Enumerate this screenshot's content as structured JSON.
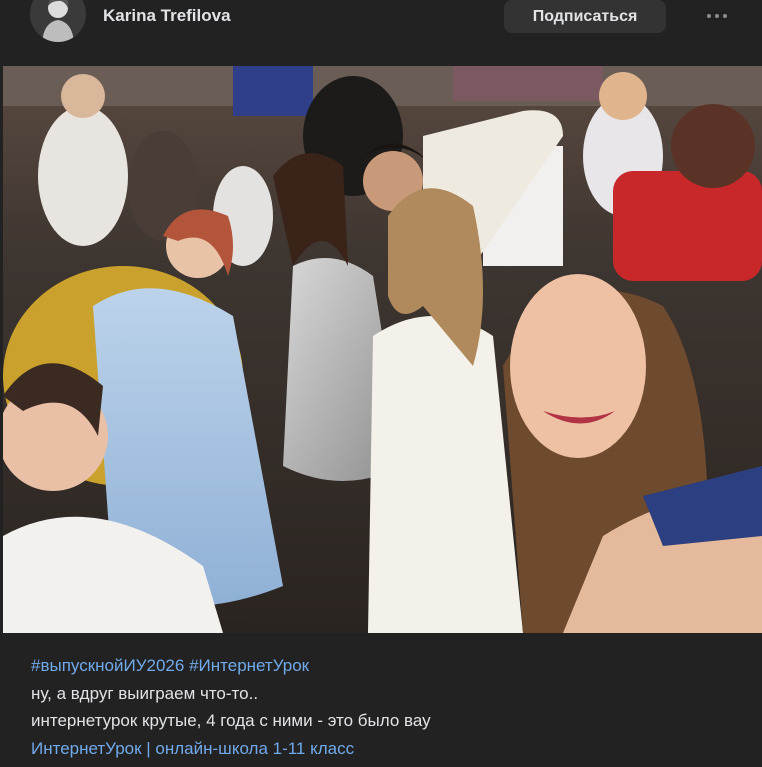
{
  "author": {
    "name": "Karina Trefilova"
  },
  "header": {
    "subscribe_label": "Подписаться",
    "more_icon": "more-horizontal-icon"
  },
  "post": {
    "hashtags": [
      "#выпускнойИУ2026",
      "#ИнтернетУрок"
    ],
    "lines": [
      "ну, а вдруг выиграем что-то..",
      "интернетурок крутые, 4 года с ними - это было вау"
    ],
    "community_link": "ИнтернетУрок | онлайн-школа 1-11 класс"
  },
  "colors": {
    "background": "#222222",
    "link": "#71aaeb",
    "text": "#e1e3e6",
    "button_bg": "#333333"
  }
}
